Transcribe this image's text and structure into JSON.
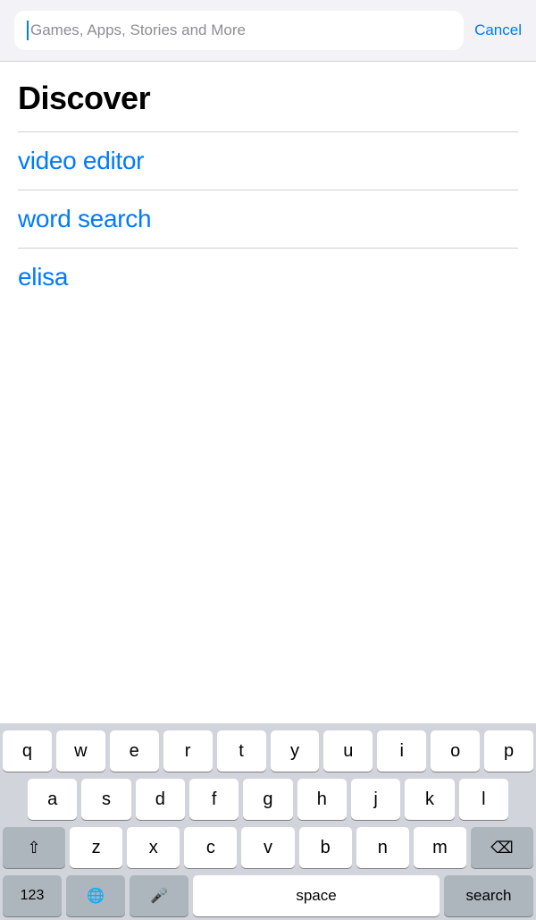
{
  "searchBar": {
    "placeholder": "Games, Apps, Stories and More",
    "cancelLabel": "Cancel"
  },
  "discover": {
    "title": "Discover",
    "suggestions": [
      {
        "text": "video editor"
      },
      {
        "text": "word search"
      },
      {
        "text": "elisa"
      }
    ]
  },
  "keyboard": {
    "rows": [
      [
        "q",
        "w",
        "e",
        "r",
        "t",
        "y",
        "u",
        "i",
        "o",
        "p"
      ],
      [
        "a",
        "s",
        "d",
        "f",
        "g",
        "h",
        "j",
        "k",
        "l"
      ],
      [
        "z",
        "x",
        "c",
        "v",
        "b",
        "n",
        "m"
      ],
      [
        "123",
        "space",
        "search"
      ]
    ],
    "spaceLabel": "space",
    "searchLabel": "search",
    "numberLabel": "123"
  }
}
